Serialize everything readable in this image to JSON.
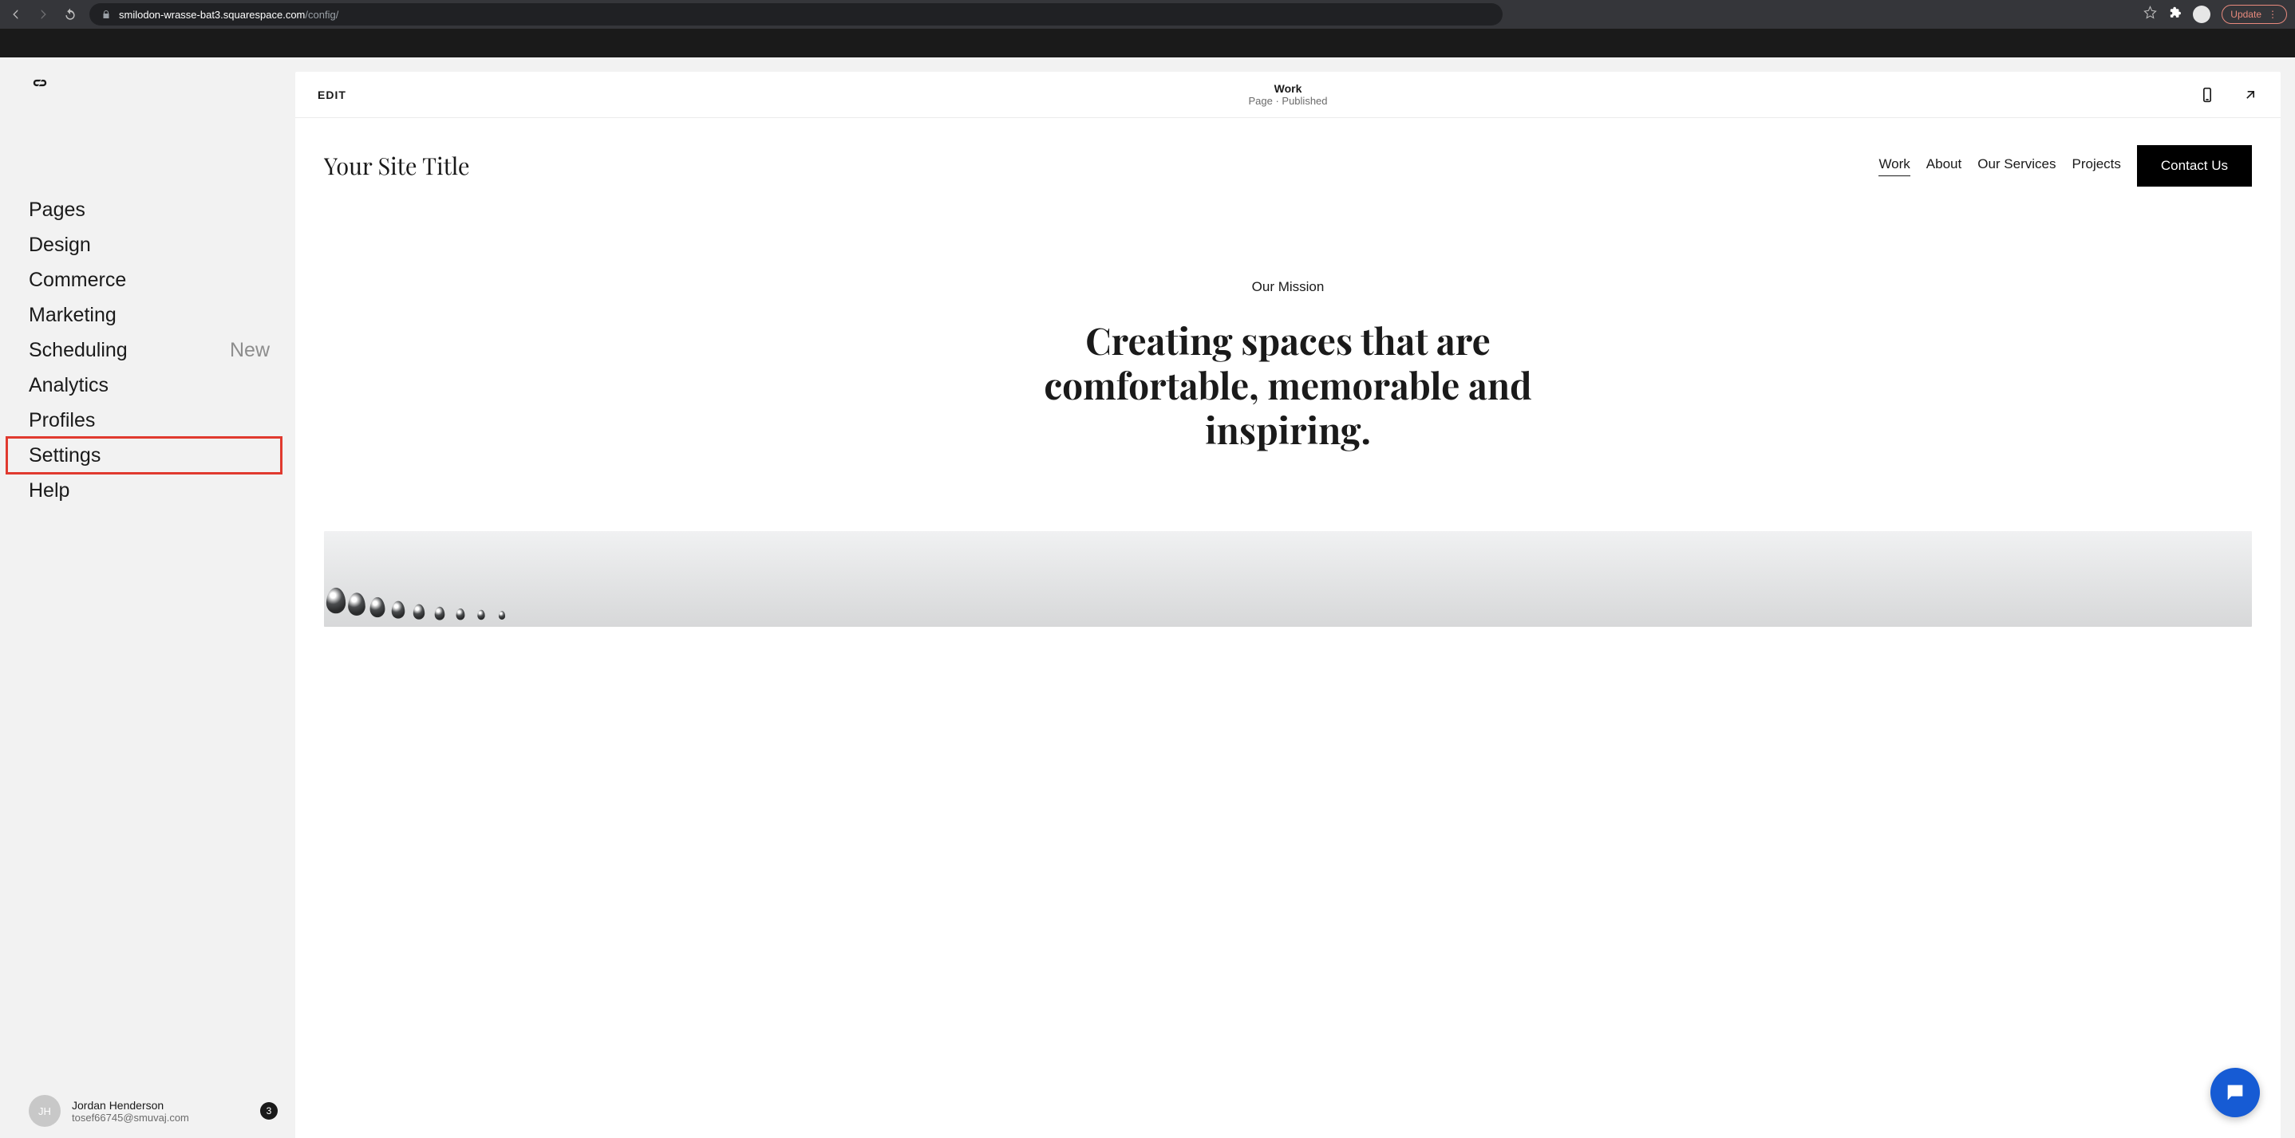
{
  "browser": {
    "url_host": "smilodon-wrasse-bat3.squarespace.com",
    "url_path": "/config/",
    "update_label": "Update"
  },
  "sidebar": {
    "items": [
      {
        "label": "Pages"
      },
      {
        "label": "Design"
      },
      {
        "label": "Commerce"
      },
      {
        "label": "Marketing"
      },
      {
        "label": "Scheduling",
        "badge": "New"
      },
      {
        "label": "Analytics"
      },
      {
        "label": "Profiles"
      },
      {
        "label": "Settings",
        "highlight": true
      },
      {
        "label": "Help"
      }
    ],
    "user": {
      "initials": "JH",
      "name": "Jordan Henderson",
      "email": "tosef66745@smuvaj.com",
      "notif_count": "3"
    }
  },
  "preview": {
    "edit_label": "EDIT",
    "page_name": "Work",
    "page_status": "Page · Published",
    "site_title": "Your Site Title",
    "nav": [
      {
        "label": "Work",
        "active": true
      },
      {
        "label": "About"
      },
      {
        "label": "Our Services"
      },
      {
        "label": "Projects"
      }
    ],
    "cta": "Contact Us",
    "mission_label": "Our Mission",
    "mission_headline": "Creating spaces that are comfortable, memorable and inspiring."
  }
}
